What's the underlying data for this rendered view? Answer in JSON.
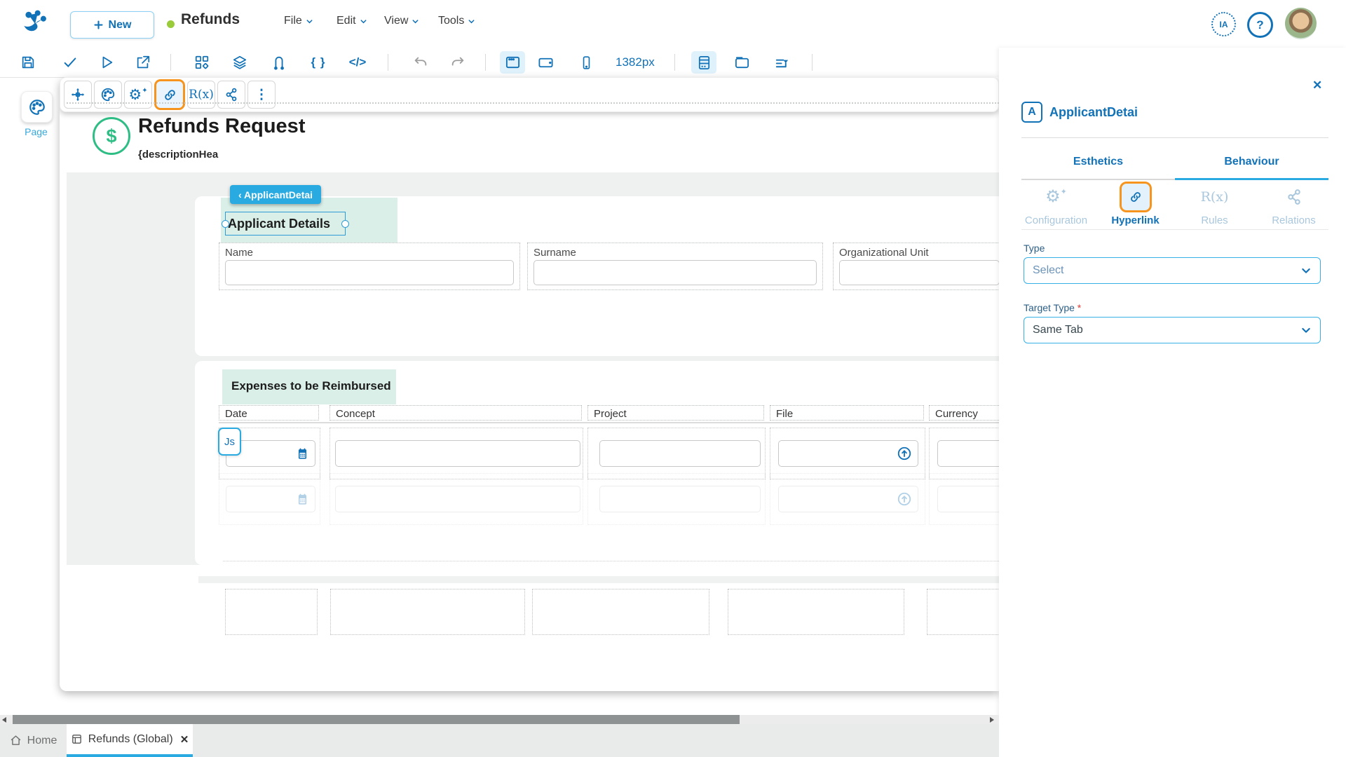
{
  "header": {
    "new_label": "New",
    "title": "Refunds",
    "menus": [
      {
        "label": "File"
      },
      {
        "label": "Edit"
      },
      {
        "label": "View"
      },
      {
        "label": "Tools"
      }
    ],
    "ia_label": "IA",
    "help_label": "?"
  },
  "toolbar": {
    "width_label": "1382px"
  },
  "left_rail": {
    "page_label": "Page"
  },
  "icons": {
    "braces": "{ }",
    "code": "</>",
    "rx": "R(x)",
    "dots": "⋮",
    "close": "✕",
    "a_letter": "A",
    "dollar": "$"
  },
  "canvas": {
    "title": "Refunds Request",
    "description_token": "{descriptionHea",
    "breadcrumb_chip": "‹ ApplicantDetai",
    "js_badge": "Js",
    "applicant": {
      "heading": "Applicant Details",
      "fields": [
        {
          "label": "Name"
        },
        {
          "label": "Surname"
        },
        {
          "label": "Organizational Unit"
        }
      ]
    },
    "expenses": {
      "heading": "Expenses to be Reimbursed",
      "columns": [
        {
          "label": "Date"
        },
        {
          "label": "Concept"
        },
        {
          "label": "Project"
        },
        {
          "label": "File"
        },
        {
          "label": "Currency"
        }
      ]
    }
  },
  "panel": {
    "title": "ApplicantDetai",
    "tabs": [
      {
        "label": "Esthetics"
      },
      {
        "label": "Behaviour"
      }
    ],
    "active_tab": "Behaviour",
    "subnav": [
      {
        "label": "Configuration"
      },
      {
        "label": "Hyperlink"
      },
      {
        "label": "Rules"
      },
      {
        "label": "Relations"
      }
    ],
    "active_subnav": "Hyperlink",
    "type_field": {
      "label": "Type",
      "value": "Select"
    },
    "target_field": {
      "label": "Target Type",
      "required_mark": "*",
      "value": "Same Tab"
    }
  },
  "bottom": {
    "tabs": [
      {
        "label": "Home"
      },
      {
        "label": "Refunds (Global)"
      }
    ]
  },
  "colors": {
    "primary_blue": "#1272B8",
    "accent_cyan": "#29ABE2",
    "accent_orange": "#F7941D",
    "selection_teal": "#d9efe7",
    "status_green": "#9ACB3B",
    "money_green": "#2EBD85"
  }
}
